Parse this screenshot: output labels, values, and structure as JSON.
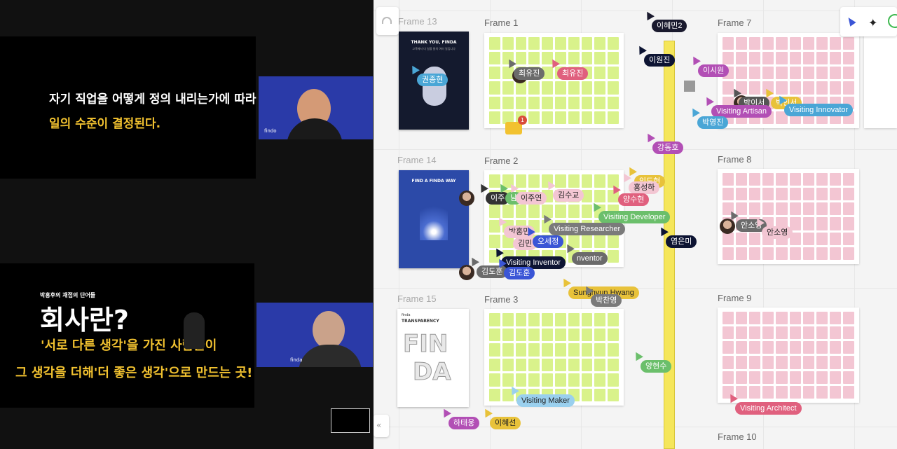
{
  "colors": {
    "accent_yellow": "#f5e65a",
    "note_green": "#d9f28b",
    "note_pink": "#f3c6d3",
    "note_yellow": "#f7ef8a"
  },
  "left": {
    "slide1": {
      "line1": "자기 직업을 어떻게 정의 내리는가에 따라",
      "line2": "일의 수준이 결정된다."
    },
    "cam1": {
      "text": "findo"
    },
    "slide2": {
      "caption": "박홍후의 재접의 단어들",
      "title": "회사란?",
      "line1": "'서로 다른 생각'을 가진 사람들이",
      "line2": "그 생각을 더해'더 좋은 생각'으로 만드는 곳!"
    },
    "cam2": {
      "text": "finda"
    }
  },
  "board": {
    "frames": [
      {
        "label": "Frame 13"
      },
      {
        "label": "Frame 1"
      },
      {
        "label": "Frame 7"
      },
      {
        "label": "Frame 14"
      },
      {
        "label": "Frame 2"
      },
      {
        "label": "Frame 8"
      },
      {
        "label": "Frame 15"
      },
      {
        "label": "Frame 3"
      },
      {
        "label": "Frame 9"
      },
      {
        "label": "Frame 10"
      }
    ],
    "posters": {
      "p13_title": "THANK YOU, FINDA",
      "p13_sub": "고객에서 더 일을 들의 여러 일입니다",
      "p14_title": "FIND A FINDA WAY",
      "p15_brand": "finda",
      "p15_title": "TRANSPARENCY",
      "p15_big1": "FIN",
      "p15_big2": "DA"
    },
    "comment_count": "1",
    "tags": [
      {
        "text": "이혜민2",
        "bg": "#1a1a2e"
      },
      {
        "text": "이원진",
        "bg": "#0d1433"
      },
      {
        "text": "권종현",
        "bg": "#4aa6d6"
      },
      {
        "text": "최유진",
        "bg": "#6b6b6b"
      },
      {
        "text": "최유진",
        "bg": "#e0607e"
      },
      {
        "text": "이시원",
        "bg": "#b24fb5"
      },
      {
        "text": "박이서",
        "bg": "#555555"
      },
      {
        "text": "박인서",
        "bg": "#e8c23a"
      },
      {
        "text": "Visiting Artisan",
        "bg": "#b24fb5"
      },
      {
        "text": "Visiting Innovator",
        "bg": "#4aa6d6"
      },
      {
        "text": "박영진",
        "bg": "#4aa6d6"
      },
      {
        "text": "강동호",
        "bg": "#b24fb5"
      },
      {
        "text": "이주",
        "bg": "#333333"
      },
      {
        "text": "남",
        "bg": "#6bbf6b"
      },
      {
        "text": "이주연",
        "bg": "#f3c6d3",
        "color": "#222"
      },
      {
        "text": "김수교",
        "bg": "#f3c6d3",
        "color": "#222"
      },
      {
        "text": "임도현",
        "bg": "#e8c23a"
      },
      {
        "text": "홍성하",
        "bg": "#f3c6d3",
        "color": "#222"
      },
      {
        "text": "양수현",
        "bg": "#e0607e"
      },
      {
        "text": "Visiting Developer",
        "bg": "#6bbf6b"
      },
      {
        "text": "Visiting Researcher",
        "bg": "#7a7a7a"
      },
      {
        "text": "박홍민",
        "bg": "#f3c6d3",
        "color": "#222"
      },
      {
        "text": "김민",
        "bg": "#f3c6d3",
        "color": "#222"
      },
      {
        "text": "오세정",
        "bg": "#3a55d6"
      },
      {
        "text": "Visiting Inventor",
        "bg": "#0d1433"
      },
      {
        "text": "nventor",
        "bg": "#6b6b6b"
      },
      {
        "text": "김도훈",
        "bg": "#6b6b6b"
      },
      {
        "text": "김도훈",
        "bg": "#3a55d6"
      },
      {
        "text": "Sunghyun Hwang",
        "bg": "#e8c23a",
        "color": "#222"
      },
      {
        "text": "박찬영",
        "bg": "#7a7a7a"
      },
      {
        "text": "염은미",
        "bg": "#0d1433"
      },
      {
        "text": "안소영",
        "bg": "#6b6b6b"
      },
      {
        "text": "안소영",
        "bg": "#f3c6d3",
        "color": "#222"
      },
      {
        "text": "양현수",
        "bg": "#6bbf6b"
      },
      {
        "text": "Visiting Maker",
        "bg": "#9ad0ee",
        "color": "#222"
      },
      {
        "text": "Visiting Architect",
        "bg": "#e0607e"
      },
      {
        "text": "하태웅",
        "bg": "#b24fb5"
      },
      {
        "text": "이혜선",
        "bg": "#e8c23a",
        "color": "#222"
      }
    ]
  }
}
